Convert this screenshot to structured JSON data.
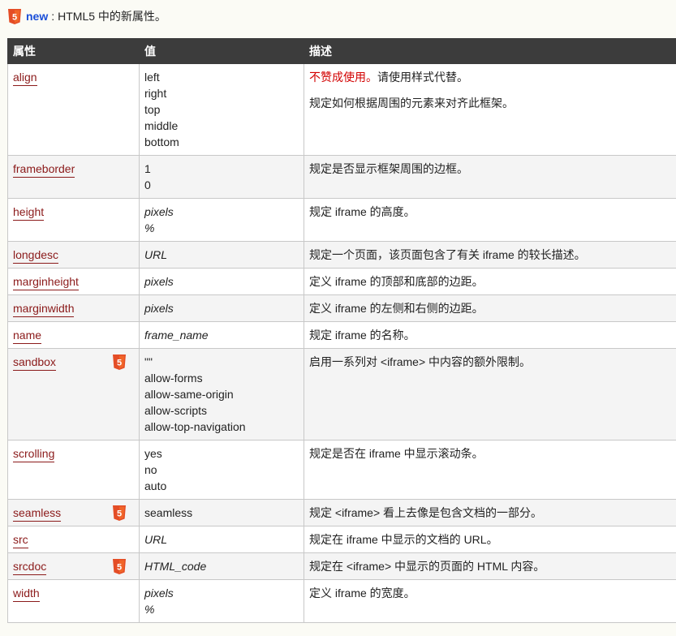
{
  "legend": {
    "new_label": "new",
    "separator": ":",
    "text": "HTML5 中的新属性。"
  },
  "headers": [
    "属性",
    "值",
    "描述"
  ],
  "rows": [
    {
      "attr": "align",
      "html5": false,
      "values": [
        "left",
        "right",
        "top",
        "middle",
        "bottom"
      ],
      "italic": false,
      "deprecated": "不赞成使用。",
      "desc": "请使用样式代替。",
      "desc2": "规定如何根据周围的元素来对齐此框架。"
    },
    {
      "attr": "frameborder",
      "html5": false,
      "values": [
        "1",
        "0"
      ],
      "italic": false,
      "desc": "规定是否显示框架周围的边框。"
    },
    {
      "attr": "height",
      "html5": false,
      "values": [
        "pixels",
        "%"
      ],
      "italic": true,
      "desc": "规定 iframe 的高度。"
    },
    {
      "attr": "longdesc",
      "html5": false,
      "values": [
        "URL"
      ],
      "italic": true,
      "desc": "规定一个页面，该页面包含了有关 iframe 的较长描述。"
    },
    {
      "attr": "marginheight",
      "html5": false,
      "values": [
        "pixels"
      ],
      "italic": true,
      "desc": "定义 iframe 的顶部和底部的边距。"
    },
    {
      "attr": "marginwidth",
      "html5": false,
      "values": [
        "pixels"
      ],
      "italic": true,
      "desc": "定义 iframe 的左侧和右侧的边距。"
    },
    {
      "attr": "name",
      "html5": false,
      "values": [
        "frame_name"
      ],
      "italic": true,
      "desc": "规定 iframe 的名称。"
    },
    {
      "attr": "sandbox",
      "html5": true,
      "values": [
        "\"\"",
        "allow-forms",
        "allow-same-origin",
        "allow-scripts",
        "allow-top-navigation"
      ],
      "italic": false,
      "desc": "启用一系列对 <iframe> 中内容的额外限制。"
    },
    {
      "attr": "scrolling",
      "html5": false,
      "values": [
        "yes",
        "no",
        "auto"
      ],
      "italic": false,
      "desc": "规定是否在 iframe 中显示滚动条。"
    },
    {
      "attr": "seamless",
      "html5": true,
      "values": [
        "seamless"
      ],
      "italic": false,
      "desc": "规定 <iframe> 看上去像是包含文档的一部分。"
    },
    {
      "attr": "src",
      "html5": false,
      "values": [
        "URL"
      ],
      "italic": true,
      "desc": "规定在 iframe 中显示的文档的 URL。"
    },
    {
      "attr": "srcdoc",
      "html5": true,
      "values": [
        "HTML_code"
      ],
      "italic": true,
      "desc": "规定在 <iframe> 中显示的页面的 HTML 内容。"
    },
    {
      "attr": "width",
      "html5": false,
      "values": [
        "pixels",
        "%"
      ],
      "italic": true,
      "desc": "定义 iframe 的宽度。"
    }
  ],
  "colors": {
    "header_bg": "#3c3c3c",
    "link": "#8b1a1a",
    "deprecated": "#d20000",
    "html5_badge": "#e44d26",
    "new_label": "#1a4ed8"
  },
  "icons": {
    "html5": "html5-icon"
  }
}
